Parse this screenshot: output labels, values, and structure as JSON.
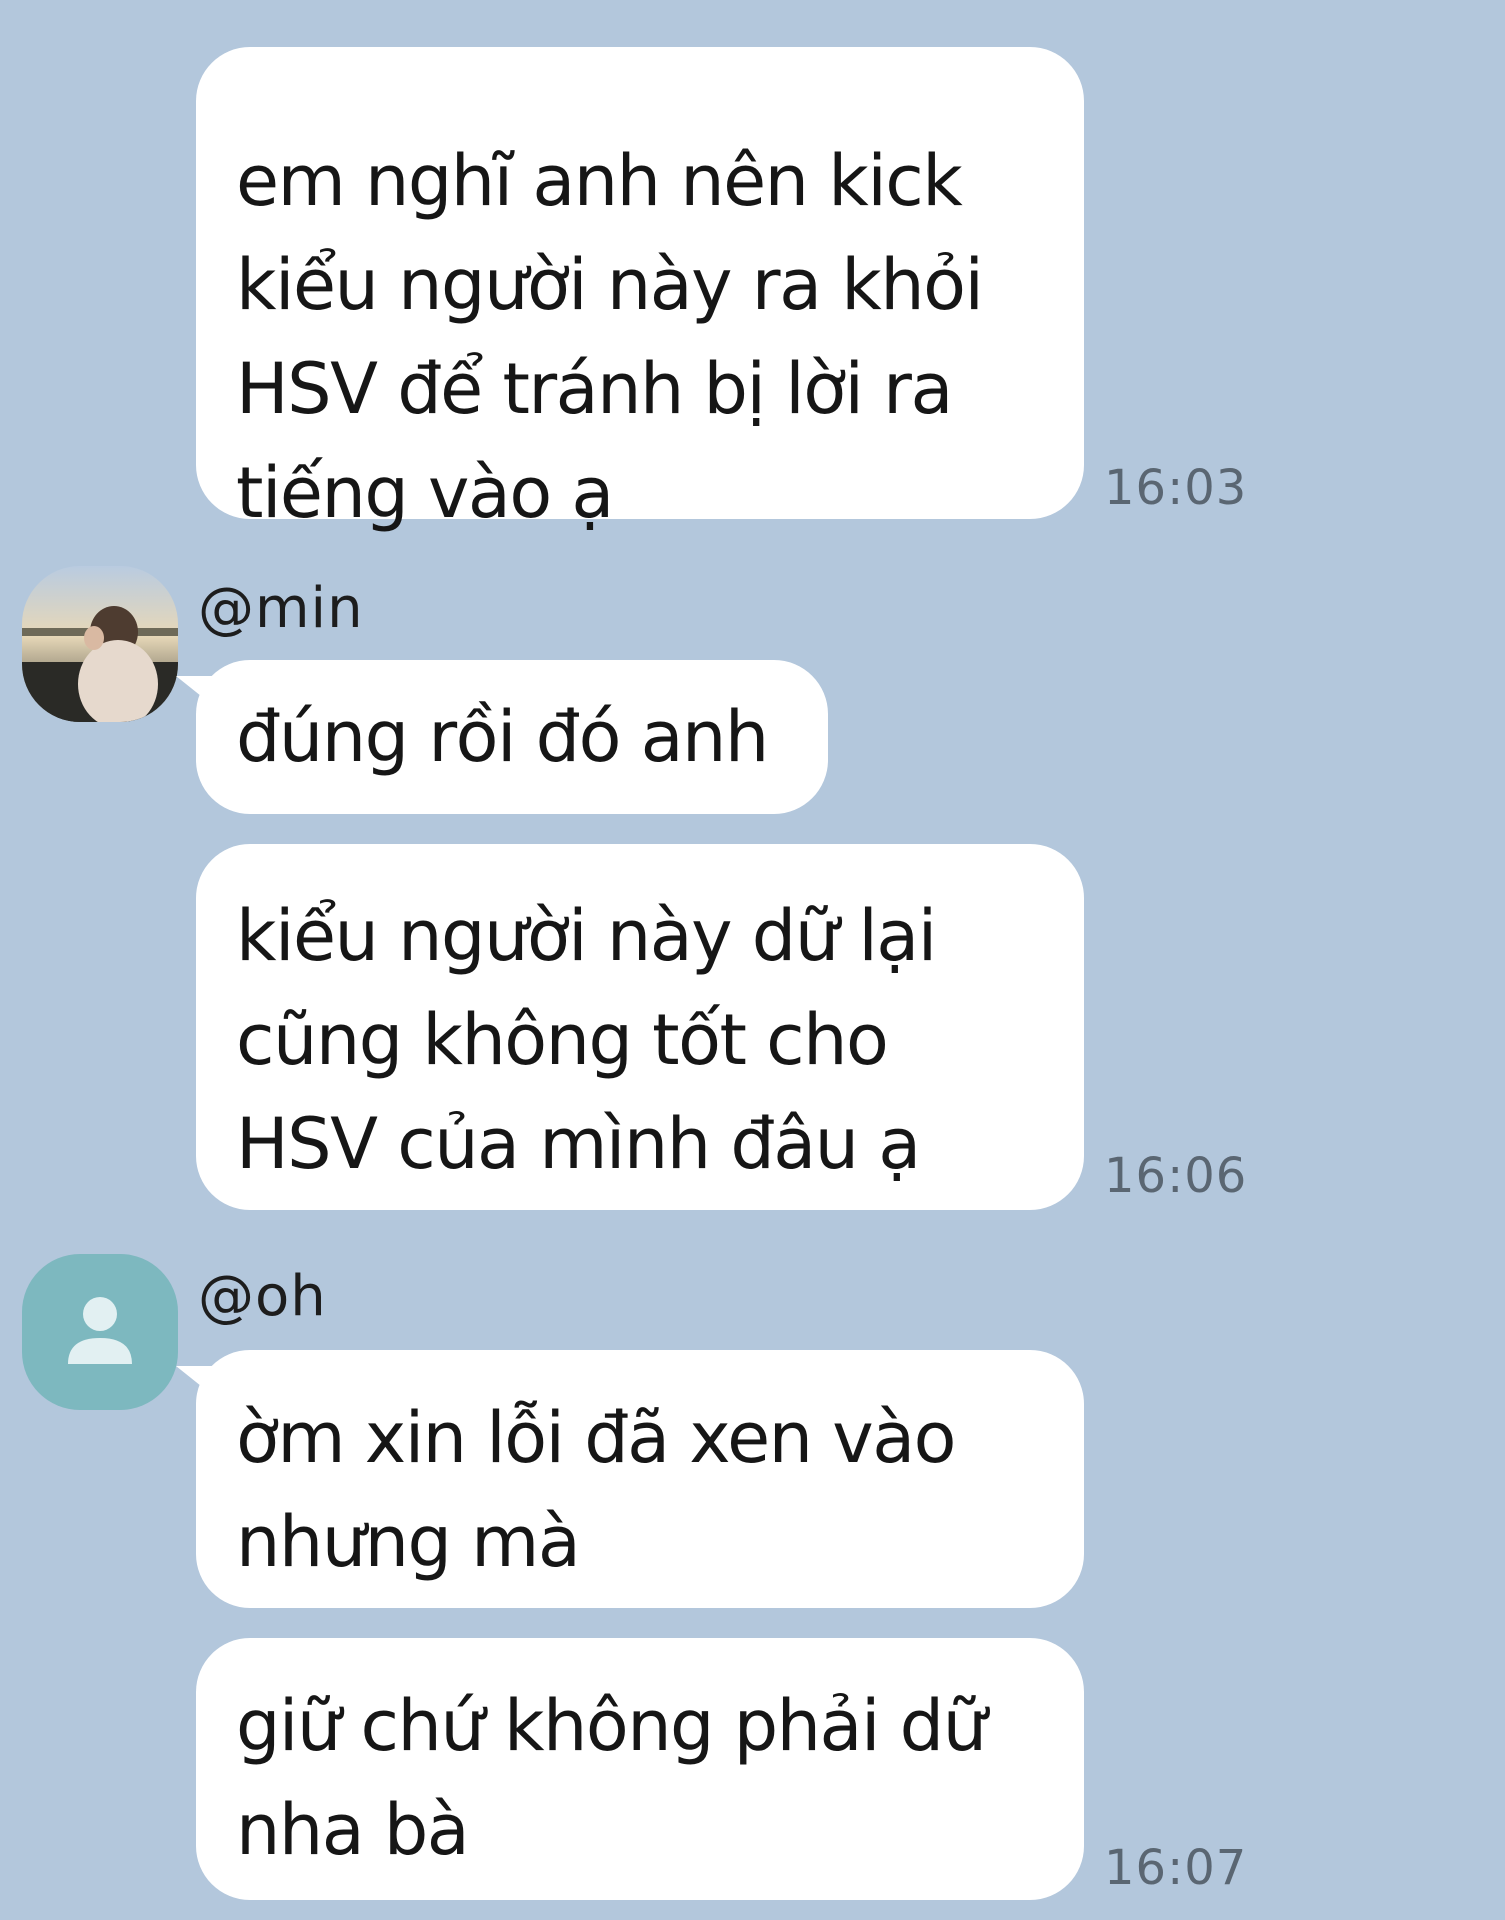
{
  "messages": [
    {
      "text": "em nghĩ anh nên kick\nkiểu người này ra khỏi\nHSV để tránh bị lời ra\ntiếng vào ạ",
      "time": "16:03"
    },
    {
      "sender": "@min",
      "avatar_icon": "photo-avatar",
      "text": "đúng rồi đó anh"
    },
    {
      "text": "kiểu người này dữ lại\ncũng không tốt cho\nHSV của mình đâu ạ",
      "time": "16:06"
    },
    {
      "sender": "@oh",
      "avatar_icon": "default-user-avatar",
      "text": "ờm xin lỗi đã xen vào\nnhưng mà"
    },
    {
      "text": "giữ chứ không phải dữ\nnha bà",
      "time": "16:07"
    }
  ],
  "colors": {
    "background": "#b3c7dc",
    "bubble": "#ffffff",
    "text": "#161616",
    "timestamp": "#5a6672",
    "default_avatar": "#7db8bf"
  }
}
